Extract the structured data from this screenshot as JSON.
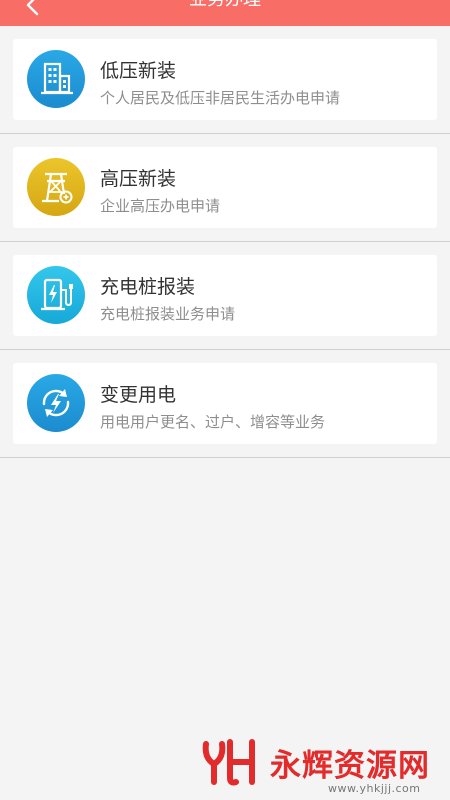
{
  "header": {
    "title": "业务办理",
    "back_icon": "chevron-left-icon",
    "background_color": "#f86d66"
  },
  "services": [
    {
      "name": "低压新装",
      "description": "个人居民及低压非居民生活办电申请",
      "icon": "building-icon",
      "icon_color": "#1f97d8"
    },
    {
      "name": "高压新装",
      "description": "企业高压办电申请",
      "icon": "power-tower-icon",
      "icon_color": "#e0b51d"
    },
    {
      "name": "充电桩报装",
      "description": "充电桩报装业务申请",
      "icon": "charging-pile-icon",
      "icon_color": "#24b7e1"
    },
    {
      "name": "变更用电",
      "description": "用电用户更名、过户、增容等业务",
      "icon": "electricity-change-icon",
      "icon_color": "#1f97d8"
    }
  ],
  "watermark": {
    "text": "永辉资源网",
    "url": "www.yhkjjj.com",
    "color": "#e22b2b"
  }
}
